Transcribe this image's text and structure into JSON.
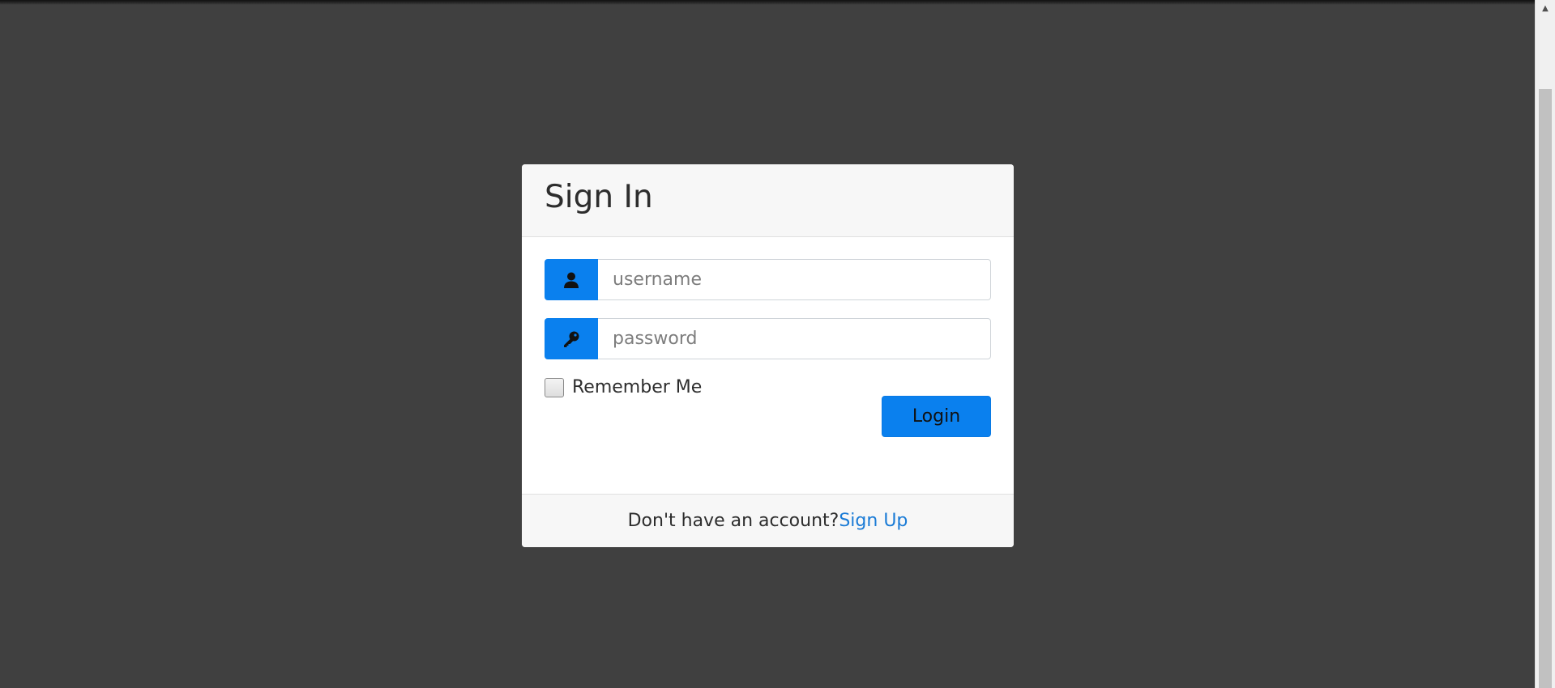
{
  "signin": {
    "title": "Sign In",
    "username": {
      "placeholder": "username",
      "value": "",
      "icon": "user-icon"
    },
    "password": {
      "placeholder": "password",
      "value": "",
      "icon": "key-icon"
    },
    "remember_label": "Remember Me",
    "remember_checked": false,
    "login_label": "Login",
    "footer_text": "Don't have an account?",
    "signup_label": "Sign Up"
  },
  "colors": {
    "accent": "#0a80ee",
    "link": "#1a7bd6",
    "background": "#404040",
    "card_header": "#f7f7f7"
  },
  "scrollbar": {
    "up_arrow_icon": "chevron-up-icon"
  }
}
